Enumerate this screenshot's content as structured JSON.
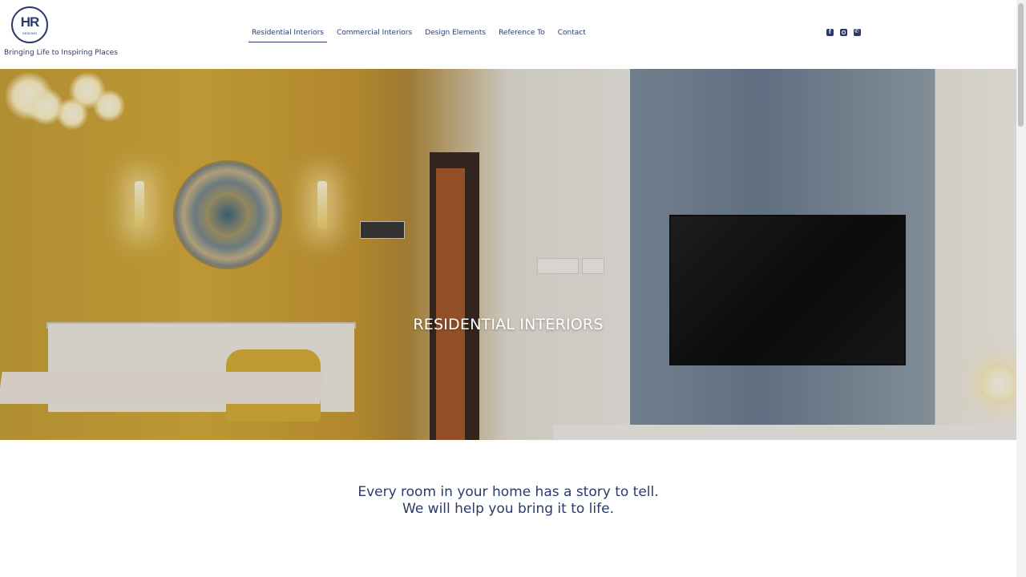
{
  "header": {
    "logo": {
      "initials": "HR",
      "subtitle": "DESIGNS",
      "tagline": "Bringing Life to Inspiring Places"
    },
    "nav": [
      {
        "label": "Residential Interiors",
        "active": true
      },
      {
        "label": "Commercial Interiors",
        "active": false
      },
      {
        "label": "Design Elements",
        "active": false
      },
      {
        "label": "Reference To",
        "active": false
      },
      {
        "label": "Contact",
        "active": false
      }
    ],
    "social_icons": [
      "facebook-icon",
      "instagram-icon",
      "phone-icon"
    ]
  },
  "hero": {
    "title": "RESIDENTIAL INTERIORS"
  },
  "intro": {
    "line1": "Every room in your home has a story to tell.",
    "line2": "We will help you bring it to life."
  },
  "colors": {
    "brand": "#2b3a6b",
    "background": "#ffffff",
    "hero_title": "#ffffff"
  }
}
